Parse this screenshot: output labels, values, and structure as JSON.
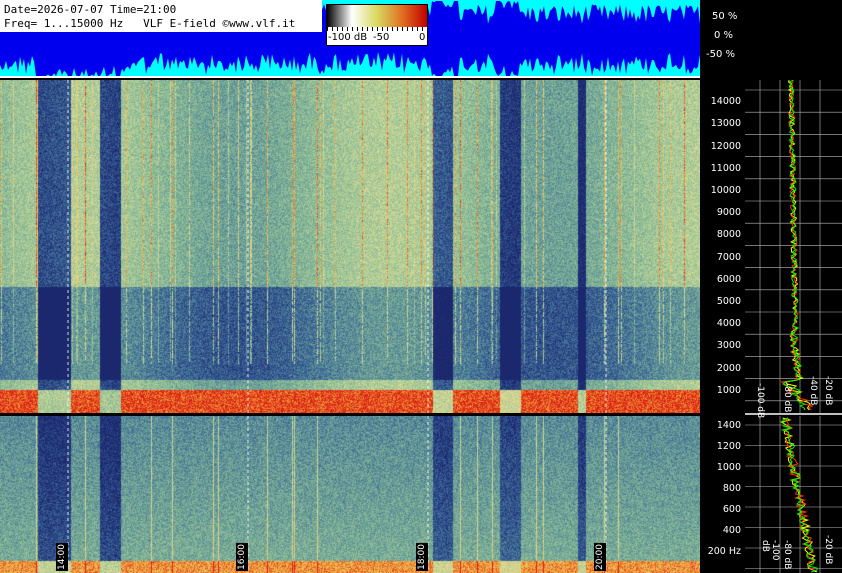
{
  "header": {
    "line1": "Date=2026-07-07 Time=21:00",
    "line2": "Freq= 1...15000 Hz   VLF E-field ©www.vlf.it"
  },
  "colorbar": {
    "labels": [
      "-100 dB",
      "-50",
      "0"
    ],
    "colors": [
      "#000000",
      "#ffffff",
      "#e0d000",
      "#e06000",
      "#c00000"
    ]
  },
  "chart_data": [
    {
      "type": "area",
      "name": "amplitude-strip",
      "ylabel_ticks": [
        "50 %",
        "0 %",
        "-50 %"
      ],
      "colors": {
        "background": "#00ffff",
        "fill": "#0000ee"
      }
    },
    {
      "type": "heatmap",
      "name": "spectrogram-full",
      "frequency_range_hz": [
        1,
        15000
      ],
      "y_ticks": [
        14000,
        13000,
        12000,
        11000,
        10000,
        9000,
        8000,
        7000,
        6000,
        5000,
        4000,
        3000,
        2000,
        1000
      ],
      "x_time_labels": [
        "14:00",
        "16:00",
        "18:00",
        "20:00"
      ],
      "palette": [
        "#1c2a78",
        "#3c6aa0",
        "#7aa898",
        "#d8dc9a",
        "#f0c040",
        "#e04010"
      ]
    },
    {
      "type": "heatmap",
      "name": "spectrogram-low",
      "frequency_range_hz": [
        1,
        1500
      ],
      "y_ticks": [
        "1400",
        "1200",
        "1000",
        "800",
        "600",
        "400",
        "200 Hz"
      ],
      "x_time_labels": [
        "14:00",
        "16:00",
        "18:00",
        "20:00"
      ]
    },
    {
      "type": "line",
      "name": "spectrum-profile",
      "x_ticks": [
        "-100 dB",
        "-80 dB",
        "-40 dB",
        "-20 dB"
      ],
      "series_colors": [
        "#ffff00",
        "#ff3000",
        "#00ff00"
      ]
    }
  ]
}
